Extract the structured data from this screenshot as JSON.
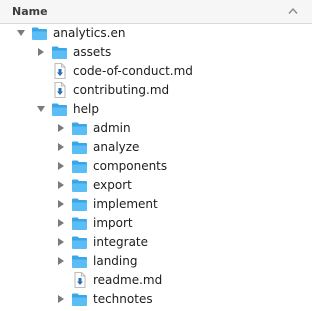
{
  "header": {
    "title": "Name",
    "sort_icon": "chevron-up-icon"
  },
  "colors": {
    "folder": "#3aa6e8",
    "folder_tab": "#5bbdf5",
    "file_badge": "#2a6fb0"
  },
  "tree": [
    {
      "label": "analytics.en",
      "kind": "folder",
      "expanded": true,
      "depth": 0
    },
    {
      "label": "assets",
      "kind": "folder",
      "expanded": false,
      "depth": 1
    },
    {
      "label": "code-of-conduct.md",
      "kind": "file",
      "depth": 1
    },
    {
      "label": "contributing.md",
      "kind": "file",
      "depth": 1
    },
    {
      "label": "help",
      "kind": "folder",
      "expanded": true,
      "depth": 1
    },
    {
      "label": "admin",
      "kind": "folder",
      "expanded": false,
      "depth": 2
    },
    {
      "label": "analyze",
      "kind": "folder",
      "expanded": false,
      "depth": 2
    },
    {
      "label": "components",
      "kind": "folder",
      "expanded": false,
      "depth": 2
    },
    {
      "label": "export",
      "kind": "folder",
      "expanded": false,
      "depth": 2
    },
    {
      "label": "implement",
      "kind": "folder",
      "expanded": false,
      "depth": 2
    },
    {
      "label": "import",
      "kind": "folder",
      "expanded": false,
      "depth": 2
    },
    {
      "label": "integrate",
      "kind": "folder",
      "expanded": false,
      "depth": 2
    },
    {
      "label": "landing",
      "kind": "folder",
      "expanded": false,
      "depth": 2
    },
    {
      "label": "readme.md",
      "kind": "file",
      "depth": 2
    },
    {
      "label": "technotes",
      "kind": "folder",
      "expanded": false,
      "depth": 2
    }
  ]
}
